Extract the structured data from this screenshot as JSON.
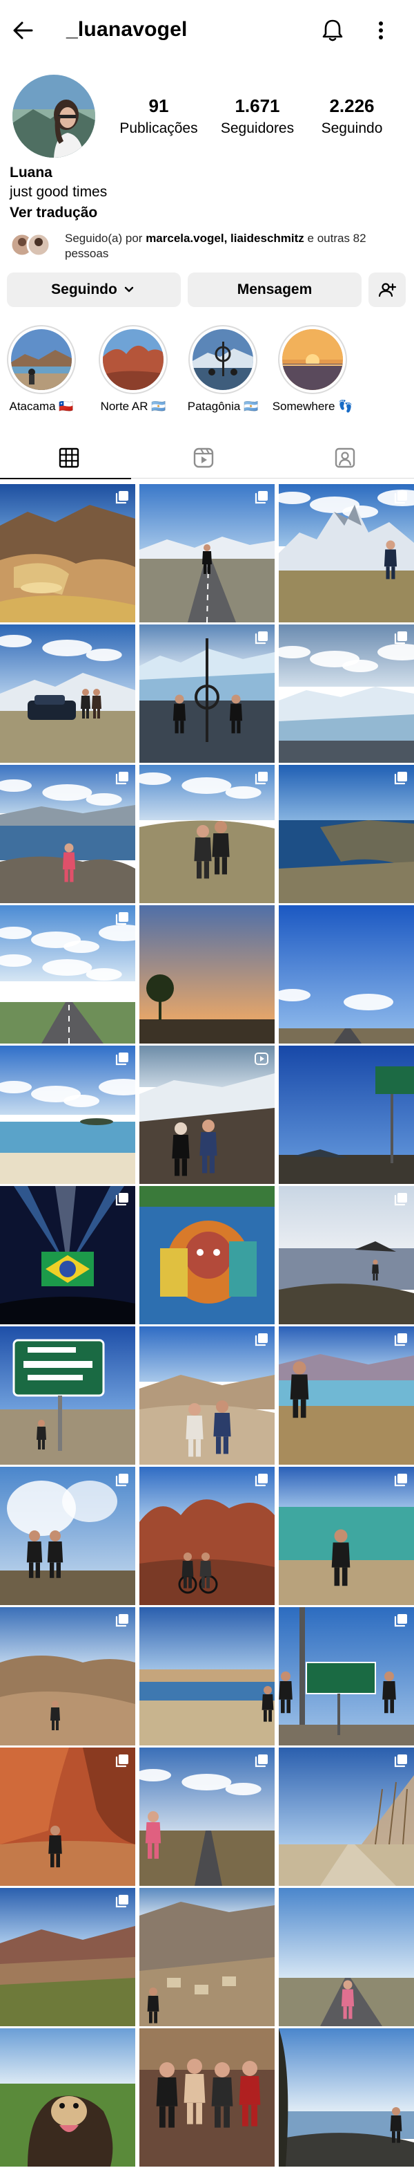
{
  "profile": {
    "username": "_luanavogel",
    "name": "Luana",
    "bio": "just good times",
    "translate": "Ver tradução",
    "stats": [
      {
        "value": "91",
        "label": "Publicações"
      },
      {
        "value": "1.671",
        "label": "Seguidores"
      },
      {
        "value": "2.226",
        "label": "Seguindo"
      }
    ],
    "followed_by": {
      "prefix": "Seguido(a) por ",
      "users": "marcela.vogel, liaideschmitz",
      "suffix": " e outras 82 pessoas"
    }
  },
  "actions": {
    "following_label": "Seguindo",
    "message_label": "Mensagem"
  },
  "highlights": [
    {
      "label": "Atacama 🇨🇱"
    },
    {
      "label": "Norte AR 🇦🇷"
    },
    {
      "label": "Patagônia 🇦🇷"
    },
    {
      "label": "Somewhere 👣"
    }
  ],
  "tabs": [
    {
      "icon": "grid-icon",
      "active": true
    },
    {
      "icon": "reels-icon",
      "active": false
    },
    {
      "icon": "tagged-icon",
      "active": false
    }
  ],
  "posts": [
    {
      "scene": "canyon",
      "badge": "multiple"
    },
    {
      "scene": "road-snow",
      "badge": "multiple"
    },
    {
      "scene": "fitzroy",
      "badge": "multiple"
    },
    {
      "scene": "car-mountain",
      "badge": "none"
    },
    {
      "scene": "glacier-people",
      "badge": "multiple"
    },
    {
      "scene": "glacier",
      "badge": "multiple"
    },
    {
      "scene": "lake-person",
      "badge": "multiple"
    },
    {
      "scene": "couple-field",
      "badge": "multiple"
    },
    {
      "scene": "sea-cliff",
      "badge": "multiple"
    },
    {
      "scene": "road-clouds",
      "badge": "multiple"
    },
    {
      "scene": "sunset-tree",
      "badge": "none"
    },
    {
      "scene": "blue-road",
      "badge": "none"
    },
    {
      "scene": "beach",
      "badge": "multiple"
    },
    {
      "scene": "snow-friends",
      "badge": "video"
    },
    {
      "scene": "road-sign",
      "badge": "none"
    },
    {
      "scene": "concert",
      "badge": "multiple"
    },
    {
      "scene": "mural",
      "badge": "none"
    },
    {
      "scene": "rocky-shore",
      "badge": "multiple"
    },
    {
      "scene": "capricornio",
      "badge": "none"
    },
    {
      "scene": "desert-sitting",
      "badge": "multiple"
    },
    {
      "scene": "lagoon-person",
      "badge": "multiple"
    },
    {
      "scene": "geyser",
      "badge": "multiple"
    },
    {
      "scene": "red-rocks-bike",
      "badge": "multiple"
    },
    {
      "scene": "green-lagoon",
      "badge": "multiple"
    },
    {
      "scene": "sand-dunes",
      "badge": "multiple"
    },
    {
      "scene": "lake-horizon",
      "badge": "none"
    },
    {
      "scene": "tropic-sign",
      "badge": "multiple"
    },
    {
      "scene": "red-canyon",
      "badge": "multiple"
    },
    {
      "scene": "road-woman",
      "badge": "multiple"
    },
    {
      "scene": "bare-trees",
      "badge": "multiple"
    },
    {
      "scene": "hills-colors",
      "badge": "multiple"
    },
    {
      "scene": "valley-town",
      "badge": "none"
    },
    {
      "scene": "road-girl",
      "badge": "none"
    },
    {
      "scene": "dog",
      "badge": "none"
    },
    {
      "scene": "group-friends",
      "badge": "none"
    },
    {
      "scene": "shore-tree",
      "badge": "none"
    }
  ],
  "colors": {
    "button_bg": "#efefef",
    "text": "#000000",
    "muted": "#262626",
    "divider": "#dbdbdb"
  }
}
